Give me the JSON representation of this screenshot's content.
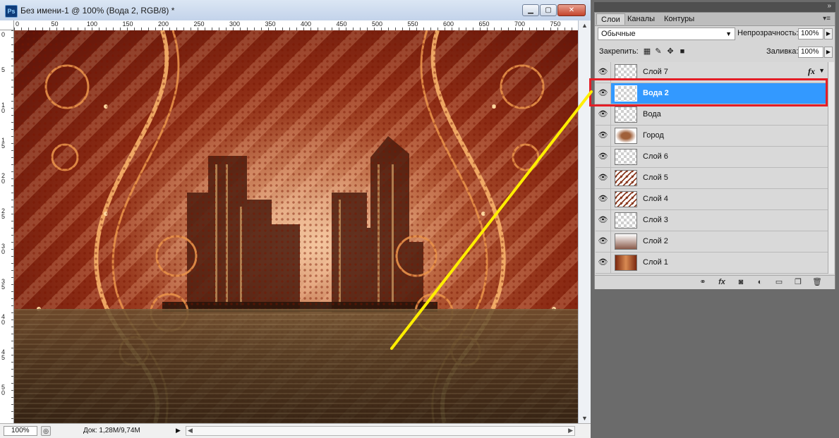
{
  "document": {
    "title": "Без имени-1 @ 100% (Вода 2, RGB/8) *",
    "app_icon": "Ps",
    "zoom": "100%",
    "doc_info": "Док: 1,28M/9,74M",
    "ruler_top": [
      "0",
      "50",
      "100",
      "150",
      "200",
      "250",
      "300",
      "350",
      "400",
      "450",
      "500",
      "550",
      "600",
      "650",
      "700",
      "750"
    ],
    "ruler_left": [
      "0",
      "5",
      "1 0",
      "1 5",
      "2 0",
      "2 5",
      "3 0",
      "3 5",
      "4 0",
      "4 5",
      "5 0"
    ]
  },
  "panel": {
    "tabs": [
      "Слои",
      "Каналы",
      "Контуры"
    ],
    "active_tab": "Слои",
    "blend_mode": "Обычные",
    "opacity_label": "Непрозрачность:",
    "opacity_value": "100%",
    "lock_label": "Закрепить:",
    "fill_label": "Заливка:",
    "fill_value": "100%",
    "layers": [
      {
        "name": "Слой 7",
        "fx": "fx",
        "selected": false
      },
      {
        "name": "Вода 2",
        "selected": true
      },
      {
        "name": "Вода",
        "selected": false
      },
      {
        "name": "Город",
        "selected": false
      },
      {
        "name": "Слой 6",
        "selected": false
      },
      {
        "name": "Слой 5",
        "selected": false
      },
      {
        "name": "Слой 4",
        "selected": false
      },
      {
        "name": "Слой 3",
        "selected": false
      },
      {
        "name": "Слой 2",
        "selected": false
      },
      {
        "name": "Слой 1",
        "selected": false
      }
    ],
    "bottom_icons": [
      "link-icon",
      "fx-icon",
      "mask-icon",
      "adjustment-icon",
      "group-folder-icon",
      "new-layer-icon",
      "trash-icon"
    ]
  },
  "colors": {
    "selection": "#3399ff",
    "annotation_red": "#e41e26",
    "annotation_yellow": "#ffee00"
  }
}
